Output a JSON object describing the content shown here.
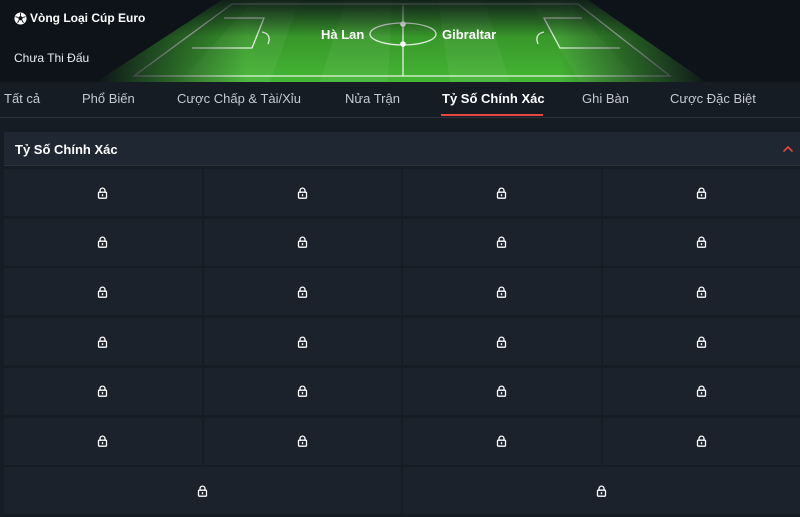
{
  "header": {
    "league": "Vòng Loại Cúp Euro",
    "status": "Chưa Thi Đấu",
    "home_team": "Hà Lan",
    "away_team": "Gibraltar"
  },
  "tabs": [
    {
      "label": "Tất cả",
      "active": false
    },
    {
      "label": "Phổ Biến",
      "active": false
    },
    {
      "label": "Cược Chấp & Tài/Xỉu",
      "active": false
    },
    {
      "label": "Nửa Trận",
      "active": false
    },
    {
      "label": "Tỷ Số Chính Xác",
      "active": true
    },
    {
      "label": "Ghi Bàn",
      "active": false
    },
    {
      "label": "Cược Đặc Biệt",
      "active": false
    }
  ],
  "section": {
    "title": "Tỷ Số Chính Xác",
    "expanded": true
  },
  "odds_grid": {
    "rows_of_four": 6,
    "rows_of_two": 1,
    "cell_state": "locked",
    "cell_icon": "lock-icon"
  },
  "colors": {
    "accent": "#e8473b",
    "background": "#161c24",
    "cell": "#1b222c",
    "pitch_green": "#3aa62c"
  }
}
